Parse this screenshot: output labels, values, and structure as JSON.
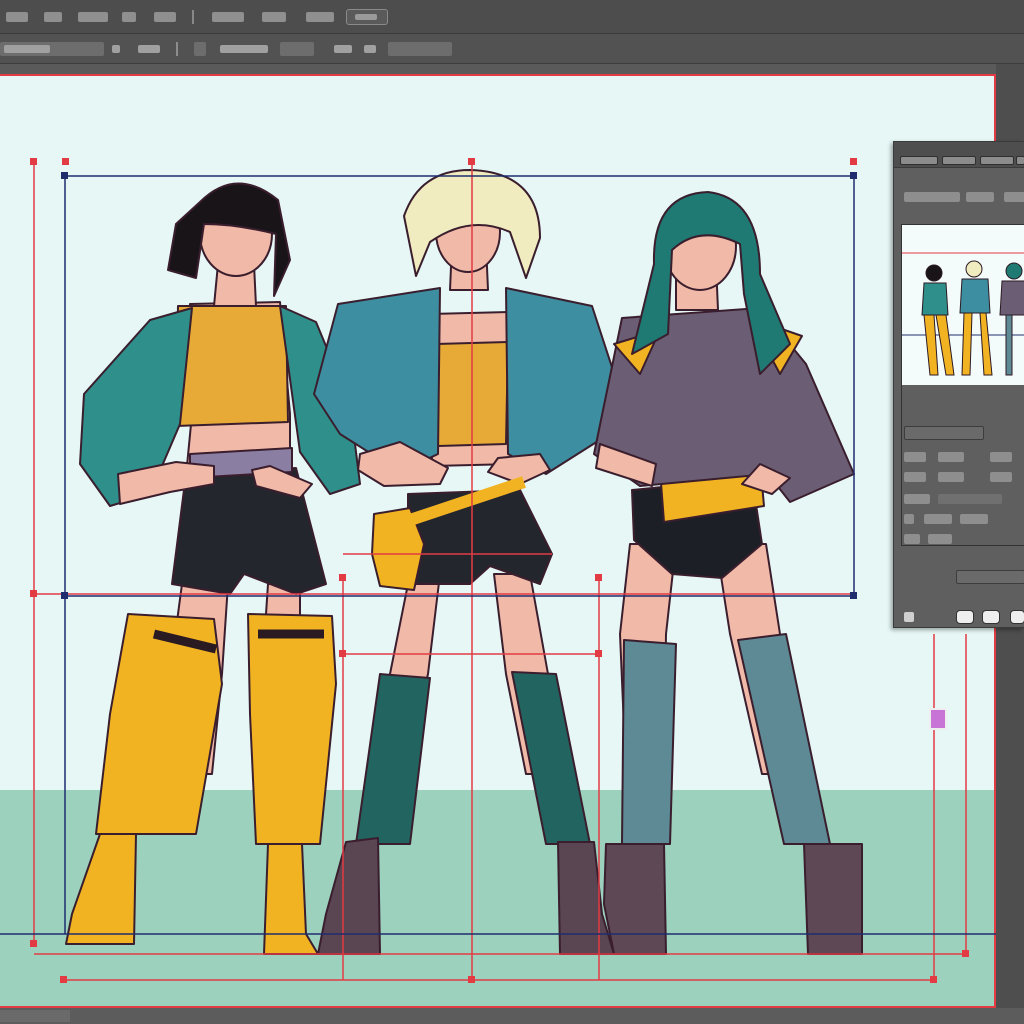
{
  "app": {
    "accent_guide_color": "#e23b43",
    "accent_box_color": "#1f2d6e",
    "canvas_color": "#e6f7f6",
    "floor_color": "#9cd1bd"
  },
  "menubar": {
    "items_unreadable": true
  },
  "toolbar": {
    "items_unreadable": true
  },
  "layers_panel": {
    "tabs_unreadable": true,
    "swatch_color": "#c873d6"
  },
  "icons": {
    "move": "move-icon",
    "brush": "brush-icon",
    "eyedropper": "eyedropper-icon"
  }
}
